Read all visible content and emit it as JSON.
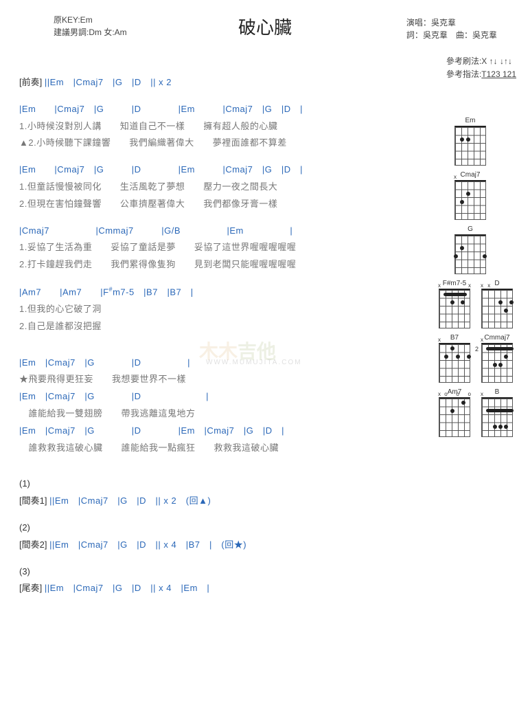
{
  "header": {
    "key_line1": "原KEY:Em",
    "key_line2": "建議男調:Dm 女:Am",
    "title": "破心臟",
    "singer_label": "演唱：",
    "singer": "吳克羣",
    "lyricist_label": "詞：",
    "lyricist": "吳克羣",
    "composer_label": "曲：",
    "composer": "吳克羣"
  },
  "refs": {
    "strum_label": "參考刷法:",
    "strum": "X ↑↓ ↓↑↓",
    "pick_label": "參考指法:",
    "pick": "T123 121"
  },
  "intro": {
    "label": "[前奏]",
    "chords": "||Em　|Cmaj7　|G　|D　|| x 2",
    "underline": "_"
  },
  "verse1_block1": {
    "chords": "|Em　　|Cmaj7　|G　　　|D　　　　|Em　　　|Cmaj7　|G　|D　|",
    "l1": " 1.小時候沒對別人講　　知道自己不一樣　　擁有超人般的心臟",
    "l2": "▲2.小時候聽下課鐘響　　我們編織著偉大　　夢裡面誰都不算差"
  },
  "verse1_block2": {
    "chords": "|Em　　|Cmaj7　|G　　　|D　　　　|Em　　　|Cmaj7　|G　|D　|",
    "l1": " 1.但童話慢慢被同化　　生活風乾了夢想　　壓力一夜之間長大",
    "l2": " 2.但現在害怕鐘聲響　　公車擠壓著偉大　　我們都像牙膏一樣"
  },
  "verse1_block3": {
    "chords": "|Cmaj7　　　　　|Cmmaj7　　　|G/B　　　　　|Em　　　　　|",
    "l1": " 1.妥協了生活為重　　妥協了童話是夢　　妥協了這世界喔喔喔喔喔",
    "l2": " 2.打卡鐘趕我們走　　我們累得像隻狗　　見到老闆只能喔喔喔喔喔"
  },
  "verse1_block4": {
    "chords_a": "|Am7　　|Am7　　|F",
    "chords_sharp": "#",
    "chords_b": "m7-5　|B7　|B7　|",
    "l1": " 1.但我的心它破了洞",
    "l2": " 2.自己是誰都沒把握"
  },
  "chorus": {
    "c1": "|Em　|Cmaj7　|G　　　　|D　　　　　|",
    "l1": "★飛要飛得更狂妄　　我想要世界不一樣",
    "c2": "|Em　|Cmaj7　|G　　　　|D　　　　　　　|",
    "l2": "　誰能給我一雙翅膀　　帶我逃離這鬼地方",
    "c3": "|Em　|Cmaj7　|G　　　　|D　　　　|Em　|Cmaj7　|G　|D　|",
    "l3": "　誰救救我這破心臟　　誰能給我一點瘋狂　　救救我這破心臟"
  },
  "outros": {
    "n1": "(1)",
    "inter1_label": "[間奏1]",
    "inter1_chords": "||Em　|Cmaj7　|G　|D　|| x 2　(回▲)",
    "n2": "(2)",
    "inter2_label": "[間奏2]",
    "inter2_chords": "||Em　|Cmaj7　|G　|D　|| x 4　|B7　|　(回★)",
    "n3": "(3)",
    "outro_label": "[尾奏]",
    "outro_chords": "||Em　|Cmaj7　|G　|D　|| x 4　|Em　|"
  },
  "watermark": {
    "w1": "木木",
    "w2": "吉他",
    "sub": "WWW.MUMUJITA.COM"
  },
  "diagrams": [
    {
      "name": "Em"
    },
    {
      "name": "Cmaj7"
    },
    {
      "name": "G"
    },
    {
      "name": "F#m7-5"
    },
    {
      "name": "D"
    },
    {
      "name": "B7"
    },
    {
      "name": "Cmmaj7"
    },
    {
      "name": "Am7"
    },
    {
      "name": "B"
    }
  ]
}
